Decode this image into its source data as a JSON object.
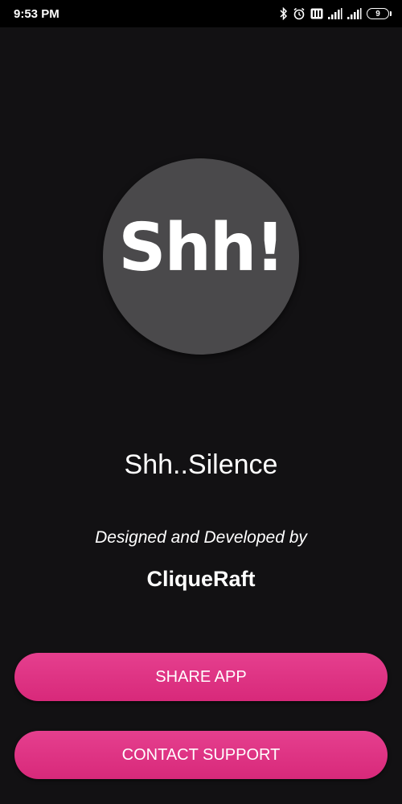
{
  "status_bar": {
    "time": "9:53 PM",
    "icons": [
      "bluetooth-icon",
      "alarm-icon",
      "volte-icon",
      "signal-icon",
      "signal-icon",
      "battery-icon"
    ],
    "battery_level": "9"
  },
  "app": {
    "logo_text": "Shh!",
    "name": "Shh..Silence",
    "designed_by": "Designed and Developed by",
    "developer": "CliqueRaft"
  },
  "buttons": {
    "share": "SHARE APP",
    "contact": "CONTACT SUPPORT"
  },
  "colors": {
    "background": "#121113",
    "logo_circle": "#4a494b",
    "button": "#de3384"
  }
}
